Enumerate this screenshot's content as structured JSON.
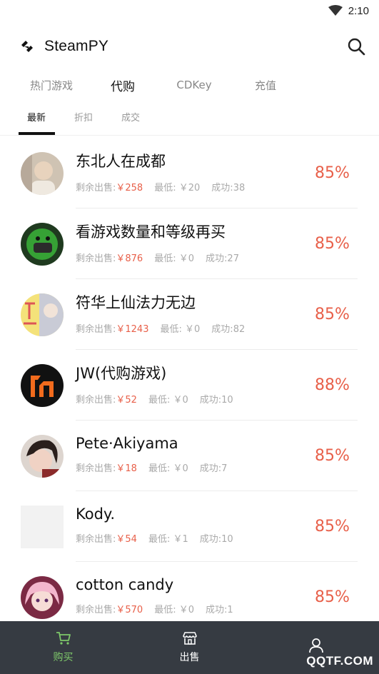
{
  "status": {
    "time": "2:10"
  },
  "app": {
    "title": "SteamPY"
  },
  "main_tabs": [
    {
      "label": "热门游戏"
    },
    {
      "label": "代购"
    },
    {
      "label": "CDKey"
    },
    {
      "label": "充值"
    }
  ],
  "sub_tabs": [
    {
      "label": "最新"
    },
    {
      "label": "折扣"
    },
    {
      "label": "成交"
    }
  ],
  "sellers": [
    {
      "name": "东北人在成都",
      "stock_label": "剩余出售:",
      "stock": "￥258",
      "min_label": "最低:",
      "min": "￥20",
      "success_label": "成功:",
      "success": "38",
      "discount": "85%"
    },
    {
      "name": "看游戏数量和等级再买",
      "stock_label": "剩余出售:",
      "stock": "￥876",
      "min_label": "最低:",
      "min": "￥0",
      "success_label": "成功:",
      "success": "27",
      "discount": "85%"
    },
    {
      "name": "符华上仙法力无边",
      "stock_label": "剩余出售:",
      "stock": "￥1243",
      "min_label": "最低:",
      "min": "￥0",
      "success_label": "成功:",
      "success": "82",
      "discount": "85%"
    },
    {
      "name": "JW(代购游戏)",
      "stock_label": "剩余出售:",
      "stock": "￥52",
      "min_label": "最低:",
      "min": "￥0",
      "success_label": "成功:",
      "success": "10",
      "discount": "88%"
    },
    {
      "name": "Pete·Akiyama",
      "stock_label": "剩余出售:",
      "stock": "￥18",
      "min_label": "最低:",
      "min": "￥0",
      "success_label": "成功:",
      "success": "7",
      "discount": "85%"
    },
    {
      "name": "Kody.",
      "stock_label": "剩余出售:",
      "stock": "￥54",
      "min_label": "最低:",
      "min": "￥1",
      "success_label": "成功:",
      "success": "10",
      "discount": "85%"
    },
    {
      "name": "cotton candy",
      "stock_label": "剩余出售:",
      "stock": "￥570",
      "min_label": "最低:",
      "min": "￥0",
      "success_label": "成功:",
      "success": "1",
      "discount": "85%"
    }
  ],
  "bottom_nav": [
    {
      "label": "购买",
      "icon": "cart-icon"
    },
    {
      "label": "出售",
      "icon": "shop-icon"
    },
    {
      "label": "",
      "icon": "user-icon"
    }
  ],
  "watermark": "QQTF.COM",
  "colors": {
    "accent": "#e8604a",
    "nav_bg": "#363b42",
    "nav_active": "#7ec86a"
  }
}
